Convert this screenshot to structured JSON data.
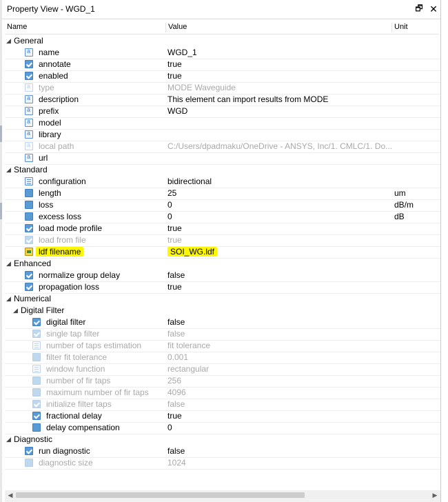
{
  "window": {
    "title": "Property View - WGD_1",
    "restore_glyph": "🗗",
    "close_glyph": "✕"
  },
  "columns": {
    "name": "Name",
    "value": "Value",
    "unit": "Unit"
  },
  "glyphs": {
    "expanded": "◢",
    "scroll_left": "◀",
    "scroll_right": "▶"
  },
  "groups": [
    {
      "label": "General",
      "rows": [
        {
          "name": "name",
          "value": "WGD_1",
          "unit": "",
          "icon": "text",
          "disabled": false
        },
        {
          "name": "annotate",
          "value": "true",
          "unit": "",
          "icon": "check",
          "disabled": false
        },
        {
          "name": "enabled",
          "value": "true",
          "unit": "",
          "icon": "check",
          "disabled": false
        },
        {
          "name": "type",
          "value": "MODE Waveguide",
          "unit": "",
          "icon": "text",
          "disabled": true
        },
        {
          "name": "description",
          "value": "This element can import results from MODE",
          "unit": "",
          "icon": "text",
          "disabled": false
        },
        {
          "name": "prefix",
          "value": "WGD",
          "unit": "",
          "icon": "text",
          "disabled": false
        },
        {
          "name": "model",
          "value": "",
          "unit": "",
          "icon": "text",
          "disabled": false
        },
        {
          "name": "library",
          "value": "",
          "unit": "",
          "icon": "text",
          "disabled": false
        },
        {
          "name": "local path",
          "value": "C:/Users/dpadmaku/OneDrive - ANSYS, Inc/1. CMLC/1. Do...",
          "unit": "",
          "icon": "text",
          "disabled": true
        },
        {
          "name": "url",
          "value": "",
          "unit": "",
          "icon": "text",
          "disabled": false
        }
      ]
    },
    {
      "label": "Standard",
      "rows": [
        {
          "name": "configuration",
          "value": "bidirectional",
          "unit": "",
          "icon": "list",
          "disabled": false
        },
        {
          "name": "length",
          "value": "25",
          "unit": "um",
          "icon": "num",
          "disabled": false
        },
        {
          "name": "loss",
          "value": "0",
          "unit": "dB/m",
          "icon": "num",
          "disabled": false
        },
        {
          "name": "excess loss",
          "value": "0",
          "unit": "dB",
          "icon": "num",
          "disabled": false
        },
        {
          "name": "load mode profile",
          "value": "true",
          "unit": "",
          "icon": "check",
          "disabled": false
        },
        {
          "name": "load from file",
          "value": "true",
          "unit": "",
          "icon": "check",
          "disabled": true
        },
        {
          "name": "ldf filename",
          "value": "SOI_WG.ldf",
          "unit": "",
          "icon": "file",
          "disabled": false,
          "highlight": true
        }
      ]
    },
    {
      "label": "Enhanced",
      "rows": [
        {
          "name": "normalize group delay",
          "value": "false",
          "unit": "",
          "icon": "check",
          "disabled": false
        },
        {
          "name": "propagation loss",
          "value": "true",
          "unit": "",
          "icon": "check",
          "disabled": false
        }
      ]
    },
    {
      "label": "Numerical",
      "rows": []
    },
    {
      "label": "Digital Filter",
      "sub": true,
      "rows": [
        {
          "name": "digital filter",
          "value": "false",
          "unit": "",
          "icon": "check",
          "disabled": false
        },
        {
          "name": "single tap filter",
          "value": "false",
          "unit": "",
          "icon": "check",
          "disabled": true
        },
        {
          "name": "number of taps estimation",
          "value": "fit tolerance",
          "unit": "",
          "icon": "list",
          "disabled": true
        },
        {
          "name": "filter fit tolerance",
          "value": "0.001",
          "unit": "",
          "icon": "num",
          "disabled": true
        },
        {
          "name": "window function",
          "value": "rectangular",
          "unit": "",
          "icon": "list",
          "disabled": true
        },
        {
          "name": "number of fir taps",
          "value": "256",
          "unit": "",
          "icon": "num",
          "disabled": true
        },
        {
          "name": "maximum number of fir taps",
          "value": "4096",
          "unit": "",
          "icon": "num",
          "disabled": true
        },
        {
          "name": "initialize filter taps",
          "value": "false",
          "unit": "",
          "icon": "check",
          "disabled": true
        },
        {
          "name": "fractional delay",
          "value": "true",
          "unit": "",
          "icon": "check",
          "disabled": false
        },
        {
          "name": "delay compensation",
          "value": "0",
          "unit": "",
          "icon": "num",
          "disabled": false
        }
      ]
    },
    {
      "label": "Diagnostic",
      "rows": [
        {
          "name": "run diagnostic",
          "value": "false",
          "unit": "",
          "icon": "check",
          "disabled": false
        },
        {
          "name": "diagnostic size",
          "value": "1024",
          "unit": "",
          "icon": "num",
          "disabled": true
        }
      ]
    }
  ],
  "colors": {
    "highlight": "#fdf700",
    "disabled_text": "#a9a9a9",
    "icon_blue": "#5b9bd5"
  }
}
